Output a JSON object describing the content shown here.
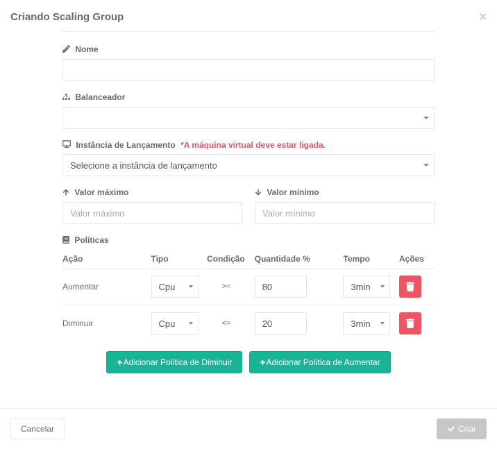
{
  "header": {
    "title": "Criando Scaling Group",
    "close": "×"
  },
  "fields": {
    "nome": {
      "label": "Nome"
    },
    "balanceador": {
      "label": "Balanceador",
      "value": ""
    },
    "instancia": {
      "label": "Instância de Lançamento",
      "warning": "*A máquina virtual deve estar ligada.",
      "value": "Selecione a instância de lançamento"
    },
    "valorMax": {
      "label": "Valor máximo",
      "placeholder": "Valor máximo"
    },
    "valorMin": {
      "label": "Valor mínimo",
      "placeholder": "Valor mínimo"
    },
    "politicas": {
      "label": "Políticas"
    }
  },
  "columns": {
    "acao": "Ação",
    "tipo": "Tipo",
    "cond": "Condição",
    "qtd": "Quantidade %",
    "tempo": "Tempo",
    "acoes": "Ações"
  },
  "rows": [
    {
      "acao": "Aumentar",
      "tipo": "Cpu",
      "cond": ">=",
      "qtd": "80",
      "tempo": "3min"
    },
    {
      "acao": "Diminuir",
      "tipo": "Cpu",
      "cond": "<=",
      "qtd": "20",
      "tempo": "3min"
    }
  ],
  "buttons": {
    "addDiminuir": "Adicionar Política de Diminuir",
    "addAumentar": "Adicionar Política de Aumentar",
    "cancelar": "Cancelar",
    "criar": "Criar"
  }
}
